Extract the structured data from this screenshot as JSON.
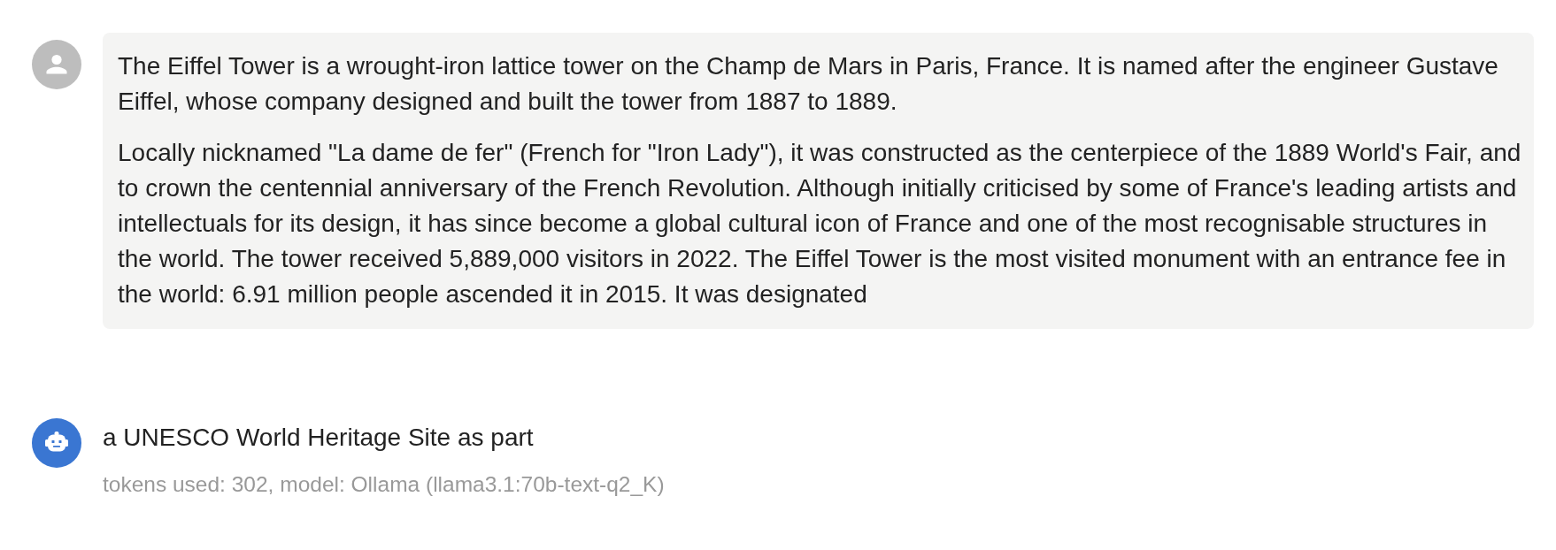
{
  "messages": [
    {
      "kind": "user",
      "paragraphs": [
        "The Eiffel Tower is a wrought-iron lattice tower on the Champ de Mars in Paris, France. It is named after the engineer Gustave Eiffel, whose company designed and built the tower from 1887 to 1889.",
        "Locally nicknamed \"La dame de fer\" (French for \"Iron Lady\"), it was constructed as the centerpiece of the 1889 World's Fair, and to crown the centennial anniversary of the French Revolution. Although initially criticised by some of France's leading artists and intellectuals for its design, it has since become a global cultural icon of France and one of the most recognisable structures in the world. The tower received 5,889,000 visitors in 2022. The Eiffel Tower is the most visited monument with an entrance fee in the world: 6.91 million people ascended it in 2015. It was designated"
      ]
    },
    {
      "kind": "assistant",
      "paragraphs": [
        "a UNESCO World Heritage Site as part"
      ],
      "meta": "tokens used: 302, model: Ollama (llama3.1:70b-text-q2_K)"
    }
  ]
}
